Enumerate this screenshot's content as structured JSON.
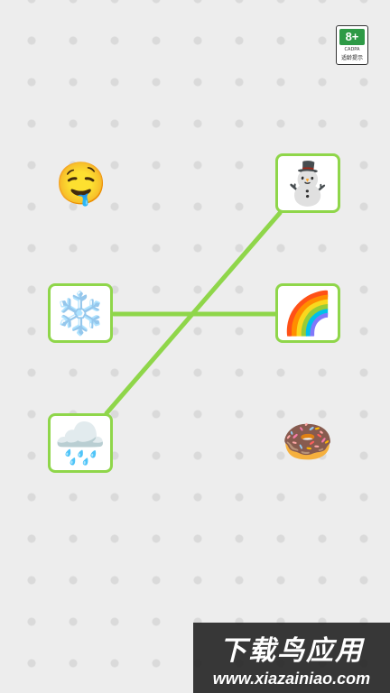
{
  "age_rating": {
    "label": "8+",
    "org": "CADPA",
    "tip": "适龄提示"
  },
  "left_items": [
    {
      "emoji": "🤤",
      "selected": false
    },
    {
      "emoji": "❄️",
      "selected": true
    },
    {
      "emoji": "🌧️",
      "selected": true
    }
  ],
  "right_items": [
    {
      "emoji": "⛄",
      "selected": true
    },
    {
      "emoji": "🌈",
      "selected": true
    },
    {
      "emoji": "🍩",
      "selected": false
    }
  ],
  "connections": [
    {
      "from": "left_2",
      "to": "right_1"
    },
    {
      "from": "left_3",
      "to": "right_1"
    }
  ],
  "line_color": "#8fd64a",
  "watermark": {
    "title": "下载鸟应用",
    "url": "www.xiazainiao.com"
  }
}
